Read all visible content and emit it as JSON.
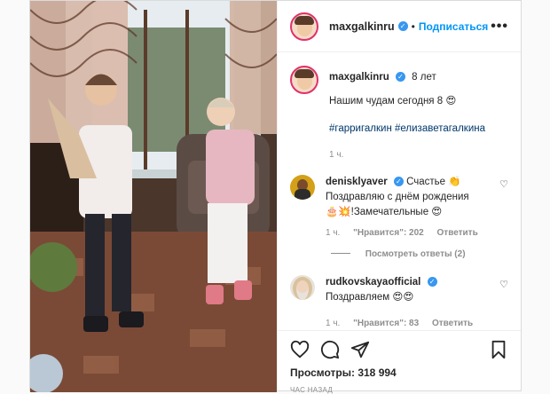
{
  "post": {
    "username": "maxgalkinru",
    "follow_label": "Подписаться",
    "more_label": "•••"
  },
  "caption": {
    "username": "maxgalkinru",
    "time": "8 лет",
    "text": "Нашим чудам сегодня 8 😍",
    "hashtags": "#гарригалкин #елизаветагалкина",
    "age": "1 ч."
  },
  "comments": [
    {
      "username": "denisklyaver",
      "line1": " Счастье 👏",
      "line2": "Поздравляю с днём рождения",
      "line3": "🎂💥!Замечательные 😍",
      "age": "1 ч.",
      "likes": "\"Нравится\": 202",
      "reply": "Ответить",
      "view_replies": "Посмотреть ответы (2)"
    },
    {
      "username": "rudkovskayaofficial",
      "line1": "Поздравляем 😍😍",
      "age": "1 ч.",
      "likes": "\"Нравится\": 83",
      "reply": "Ответить"
    }
  ],
  "footer": {
    "views": "Просмотры: 318 994",
    "ago": "ЧАС НАЗАД"
  },
  "icons": {
    "like": "heart-icon",
    "comment": "comment-icon",
    "share": "share-icon",
    "save": "bookmark-icon"
  }
}
